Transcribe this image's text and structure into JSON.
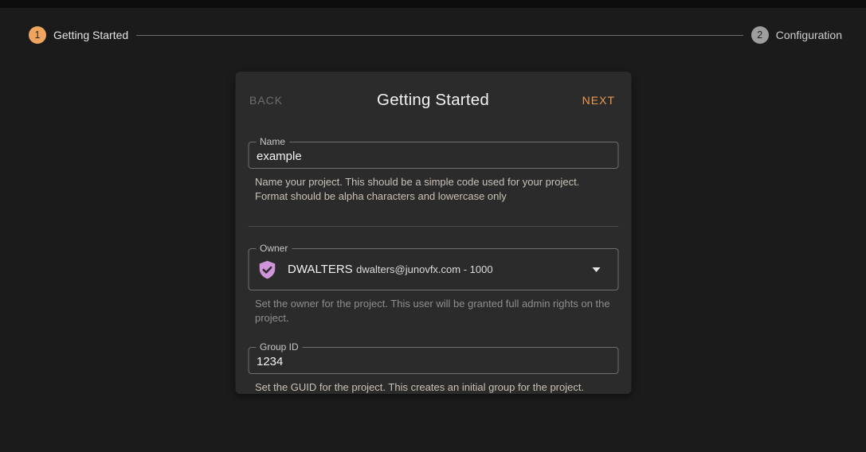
{
  "colors": {
    "page_bg": "#1b1b1c",
    "card_bg": "#2b2b2b",
    "accent_orange": "#ee9a4e",
    "step_active": "#efa55f",
    "step_inactive": "#9e9e9e",
    "shield_icon": "#cf94d9"
  },
  "stepper": {
    "steps": [
      {
        "number": "1",
        "label": "Getting Started",
        "state": "active"
      },
      {
        "number": "2",
        "label": "Configuration",
        "state": "upcoming"
      }
    ]
  },
  "card": {
    "back_label": "BACK",
    "title": "Getting Started",
    "next_label": "NEXT",
    "fields": {
      "name": {
        "label": "Name",
        "value": "example",
        "helper": "Name your project. This should be a simple code used for your project. Format should be alpha characters and lowercase only"
      },
      "owner": {
        "label": "Owner",
        "selected_name": "DWALTERS",
        "selected_detail": "dwalters@junovfx.com - 1000",
        "icon": "shield-check-icon",
        "helper": "Set the owner for the project. This user will be granted full admin rights on the project."
      },
      "group_id": {
        "label": "Group ID",
        "value": "1234",
        "helper": "Set the GUID for the project. This creates an initial group for the project."
      }
    }
  }
}
